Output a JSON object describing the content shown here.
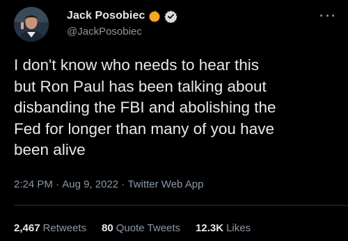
{
  "author": {
    "display_name": "Jack Posobiec",
    "handle": "@JackPosobiec",
    "emoji_icon": "orange-circle-icon",
    "verified_icon": "verified-badge-icon",
    "avatar_icon": "avatar-photo-icon"
  },
  "tweet": {
    "text": "I don't know who needs to hear this\nbut Ron Paul has been talking about\ndisbanding the FBI and abolishing the\nFed for longer than many of you have\nbeen alive"
  },
  "meta": {
    "time": "2:24 PM",
    "sep1": " · ",
    "date": "Aug 9, 2022",
    "sep2": " · ",
    "source": "Twitter Web App"
  },
  "stats": {
    "retweets_count": "2,467",
    "retweets_label": "Retweets",
    "quotes_count": "80",
    "quotes_label": "Quote Tweets",
    "likes_count": "12.3K",
    "likes_label": "Likes"
  },
  "colors": {
    "background": "#000000",
    "text": "#e7e9ea",
    "muted": "#8b98a5",
    "verified": "#d9d9d9",
    "emoji": "#f5a623"
  }
}
